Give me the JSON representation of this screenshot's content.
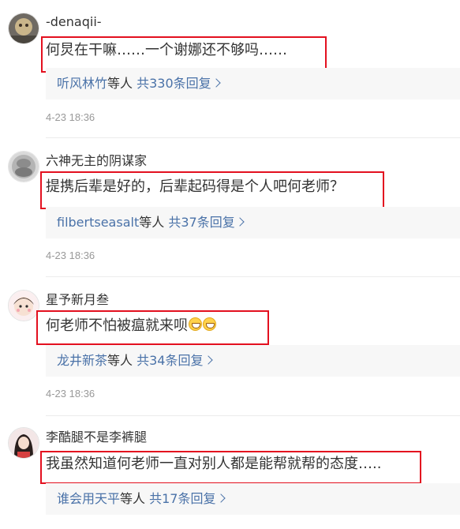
{
  "comments": [
    {
      "username": "-denaqii-",
      "content": "何炅在干嘛……一个谢娜还不够吗……",
      "reply_users": "听风林竹",
      "reply_suffix": "等人",
      "reply_count": "共330条回复",
      "timestamp": "4-23 18:36",
      "emojis": []
    },
    {
      "username": "六神无主的阴谋家",
      "content": "提携后辈是好的，后辈起码得是个人吧何老师？",
      "reply_users": "filbertseasalt",
      "reply_suffix": "等人",
      "reply_count": "共37条回复",
      "timestamp": "4-23 18:36",
      "emojis": []
    },
    {
      "username": "星予新月叁",
      "content": "何老师不怕被瘟就来呗",
      "reply_users": "龙井新茶",
      "reply_suffix": "等人",
      "reply_count": "共34条回复",
      "timestamp": "4-23 18:36",
      "emojis": [
        "grin-emoji",
        "grin-emoji"
      ]
    },
    {
      "username": "李酷腿不是李裤腿",
      "content": "我虽然知道何老师一直对别人都是能帮就帮的态度…..",
      "reply_users": "谁会用天平",
      "reply_suffix": "等人",
      "reply_count": "共17条回复",
      "timestamp": "",
      "emojis": []
    }
  ],
  "colors": {
    "highlight_border": "#e3101f",
    "link": "#4a72a8",
    "reply_background": "#f7f7f7",
    "timestamp": "#999999"
  }
}
